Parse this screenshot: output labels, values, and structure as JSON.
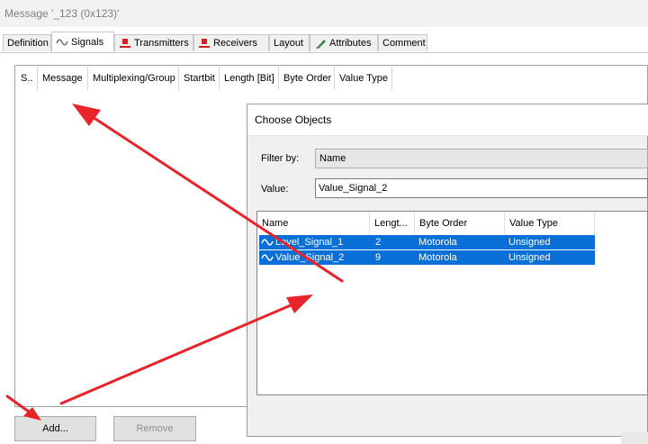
{
  "window": {
    "title": "Message '_123 (0x123)'"
  },
  "tabs": [
    {
      "label": "Definition",
      "icon": "none"
    },
    {
      "label": "Signals",
      "icon": "signal-wave-icon",
      "active": true
    },
    {
      "label": "Transmitters",
      "icon": "red-node-icon"
    },
    {
      "label": "Receivers",
      "icon": "red-node-icon"
    },
    {
      "label": "Layout",
      "icon": "none"
    },
    {
      "label": "Attributes",
      "icon": "pencil-icon"
    },
    {
      "label": "Comment",
      "icon": "none"
    }
  ],
  "signals_grid": {
    "columns": [
      "S..",
      "Message",
      "Multiplexing/Group",
      "Startbit",
      "Length [Bit]",
      "Byte Order",
      "Value Type"
    ]
  },
  "buttons": {
    "add": "Add...",
    "remove": "Remove"
  },
  "dialog": {
    "title": "Choose Objects",
    "filter_label": "Filter by:",
    "filter_value": "Name",
    "value_label": "Value:",
    "value_text": "Value_Signal_2",
    "columns": [
      "Name",
      "Lengt...",
      "Byte Order",
      "Value Type"
    ],
    "rows": [
      {
        "name": "Level_Signal_1",
        "length": "2",
        "byte_order": "Motorola",
        "value_type": "Unsigned"
      },
      {
        "name": "Value_Signal_2",
        "length": "9",
        "byte_order": "Motorola",
        "value_type": "Unsigned"
      }
    ],
    "selection_color": "#0a6fd6"
  },
  "annotation": {
    "arrow_color": "#e8232a"
  }
}
